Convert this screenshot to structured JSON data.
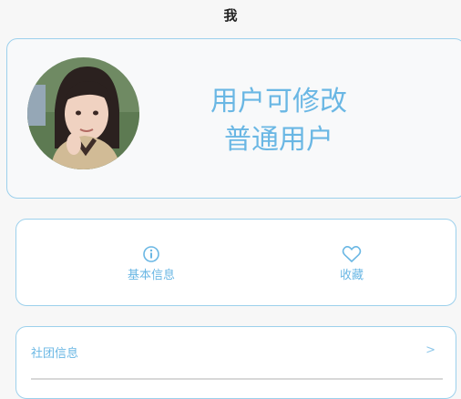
{
  "header": {
    "title": "我"
  },
  "profile": {
    "name": "用户可修改",
    "role": "普通用户",
    "avatar": "avatar-photo"
  },
  "actions": [
    {
      "icon": "info-icon",
      "label": "基本信息"
    },
    {
      "icon": "heart-icon",
      "label": "收藏"
    }
  ],
  "list": [
    {
      "label": "社团信息",
      "chevron": ">"
    }
  ],
  "colors": {
    "accent": "#6ab7e4",
    "border": "#9cd0ec",
    "background": "#f7f7f7"
  }
}
